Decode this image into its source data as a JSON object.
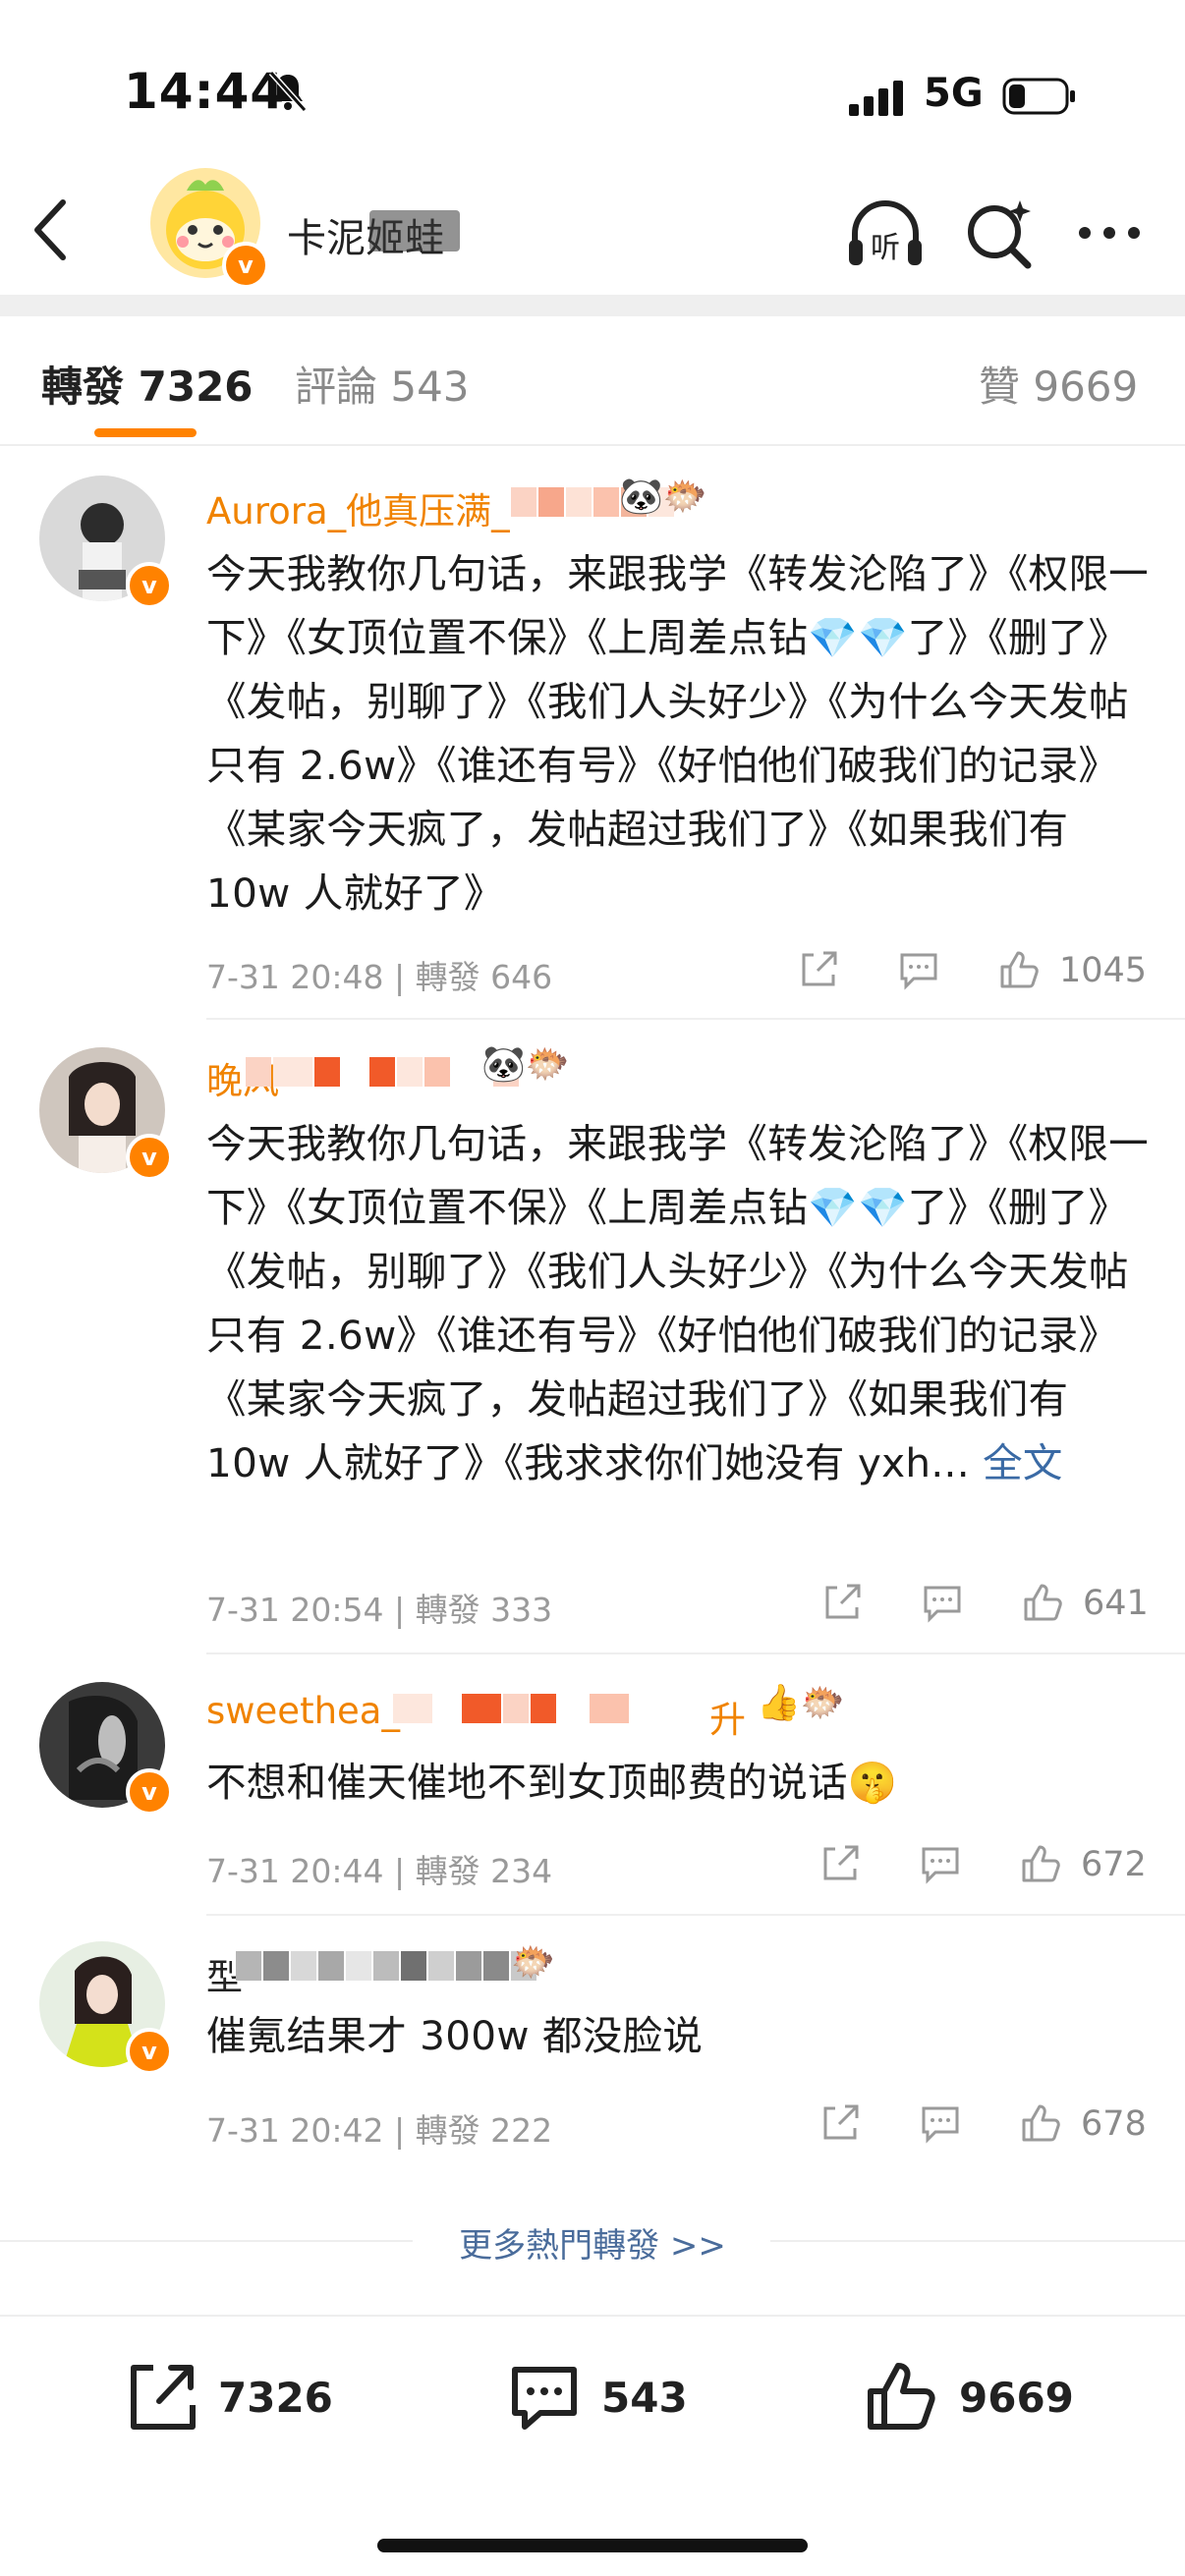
{
  "status_bar": {
    "time": "14:44",
    "network": "5G"
  },
  "header": {
    "account_name": "卡泥姬蛙"
  },
  "tabs": {
    "repost": "轉發 7326",
    "comment": "評論 543",
    "like": "贊 9669"
  },
  "posts": [
    {
      "name": "Aurora_他真压满_",
      "emoji": "🐼🐡",
      "text": "今天我教你几句话，来跟我学《转发沦陷了》《权限一下》《女顶位置不保》《上周差点钻💎💎了》《删了》《发帖，别聊了》《我们人头好少》《为什么今天发帖只有 2.6w》《谁还有号》《好怕他们破我们的记录》《某家今天疯了，发帖超过我们了》《如果我们有 10w 人就好了》",
      "meta": "7-31 20:48 | 轉發 646",
      "likes": "1045"
    },
    {
      "name": "晚风",
      "emoji": "🐼🐡",
      "text": "今天我教你几句话，来跟我学《转发沦陷了》《权限一下》《女顶位置不保》《上周差点钻💎💎了》《删了》《发帖，别聊了》《我们人头好少》《为什么今天发帖只有 2.6w》《谁还有号》《好怕他们破我们的记录》《某家今天疯了，发帖超过我们了》《如果我们有 10w 人就好了》《我求求你们她没有 yxh...",
      "full": "全文",
      "meta": "7-31 20:54 | 轉發 333",
      "likes": "641"
    },
    {
      "name": "sweethea_",
      "name_suffix": "升",
      "emoji": "👍🐡",
      "text": "不想和催天催地不到女顶邮费的说话🤫",
      "meta": "7-31 20:44 | 轉發 234",
      "likes": "672"
    },
    {
      "name": "型",
      "emoji": "🐡",
      "text": "催氪结果才 300w 都没脸说",
      "meta": "7-31 20:42 | 轉發 222",
      "likes": "678"
    }
  ],
  "more_link": "更多熱門轉發 >>",
  "bottom_bar": {
    "repost": "7326",
    "comment": "543",
    "like": "9669"
  }
}
